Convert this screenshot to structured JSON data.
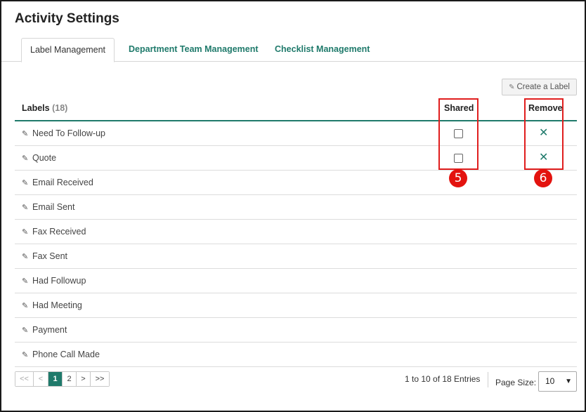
{
  "page": {
    "title": "Activity Settings"
  },
  "tabs": [
    {
      "label": "Label Management",
      "active": true
    },
    {
      "label": "Department Team Management",
      "active": false
    },
    {
      "label": "Checklist Management",
      "active": false
    }
  ],
  "toolbar": {
    "create_label": "Create a Label",
    "create_icon": "pencil-icon"
  },
  "table": {
    "header_labels": "Labels",
    "header_count": "(18)",
    "header_shared": "Shared",
    "header_remove": "Remove",
    "remove_glyph": "✕",
    "rows": [
      {
        "label": "Need To Follow-up",
        "has_controls": true,
        "shared": false
      },
      {
        "label": "Quote",
        "has_controls": true,
        "shared": false
      },
      {
        "label": "Email Received",
        "has_controls": false
      },
      {
        "label": "Email Sent",
        "has_controls": false
      },
      {
        "label": "Fax Received",
        "has_controls": false
      },
      {
        "label": "Fax Sent",
        "has_controls": false
      },
      {
        "label": "Had Followup",
        "has_controls": false
      },
      {
        "label": "Had Meeting",
        "has_controls": false
      },
      {
        "label": "Payment",
        "has_controls": false
      },
      {
        "label": "Phone Call Made",
        "has_controls": false
      }
    ]
  },
  "annotations": {
    "badge_shared": "5",
    "badge_remove": "6",
    "color": "#e3130f"
  },
  "pagination": {
    "first": "<<",
    "prev": "<",
    "pages": [
      "1",
      "2"
    ],
    "current": "1",
    "next": ">",
    "last": ">>",
    "entries": "1 to 10 of 18 Entries",
    "page_size_label": "Page Size:",
    "page_size_value": "10"
  },
  "colors": {
    "accent": "#1f7a6b",
    "highlight": "#e01e1e"
  }
}
